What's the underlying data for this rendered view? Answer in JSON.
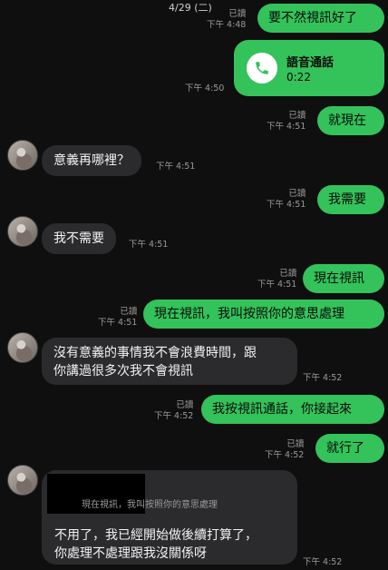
{
  "date": "4/29 (二)",
  "read": "已讀",
  "messages": [
    {
      "text": "要不然視訊好了",
      "time": "下午 4:48"
    },
    {
      "call_title": "語音通話",
      "call_duration": "0:22",
      "time": "下午 4:50"
    },
    {
      "text": "就現在",
      "time": "下午 4:51"
    },
    {
      "text": "意義再哪裡？",
      "time": "下午 4:51"
    },
    {
      "text": "我需要",
      "time": "下午 4:51"
    },
    {
      "text": "我不需要",
      "time": "下午 4:51"
    },
    {
      "text": "現在視訊",
      "time": "下午 4:51"
    },
    {
      "text": "現在視訊，我叫按照你的意思處理",
      "time": "下午 4:51"
    },
    {
      "line1": "沒有意義的事情我不會浪費時間，跟",
      "line2": "你講過很多次我不會視訊",
      "time": "下午 4:52"
    },
    {
      "text": "我按視訊通話，你接起來",
      "time": "下午 4:52"
    },
    {
      "text": "就行了",
      "time": "下午 4:52"
    },
    {
      "quote": "現在視訊，我叫按照你的意思處理",
      "line1": "不用了，我已經開始做後續打算了，",
      "line2": "你處理不處理跟我沒關係呀",
      "time": "下午 4:52"
    }
  ]
}
